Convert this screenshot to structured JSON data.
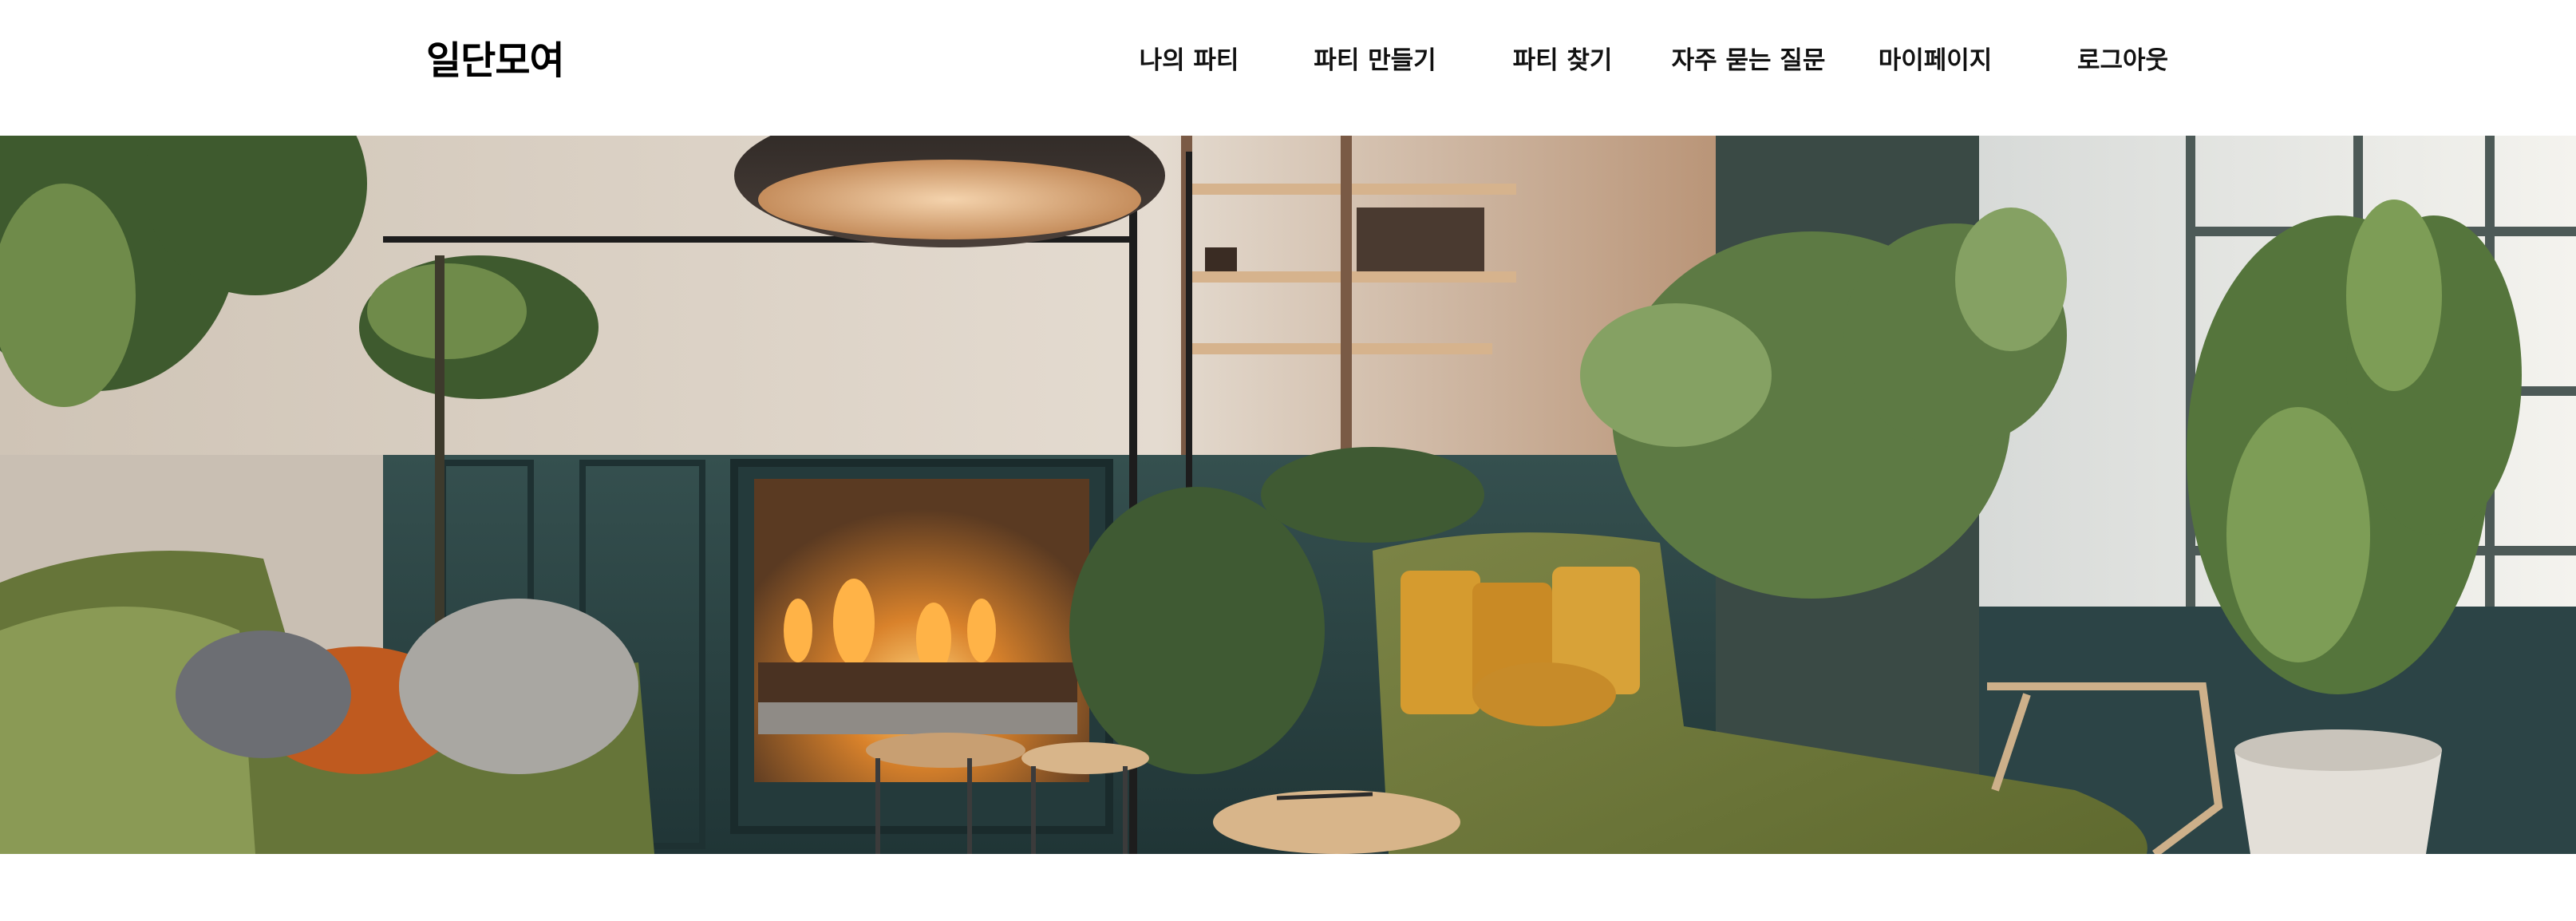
{
  "header": {
    "logo": "일단모여",
    "nav": [
      {
        "label": "나의 파티"
      },
      {
        "label": "파티 만들기"
      },
      {
        "label": "파티 찾기"
      },
      {
        "label": "자주 묻는 질문"
      },
      {
        "label": "마이페이지"
      },
      {
        "label": "로그아웃"
      }
    ]
  },
  "hero": {
    "description": "Cozy interior living room banner image"
  },
  "colors": {
    "background": "#ffffff",
    "text": "#111111",
    "wall_panel": "#2f4a4c",
    "sofa_green": "#6b7a3c",
    "cushion_mustard": "#c7922b"
  }
}
